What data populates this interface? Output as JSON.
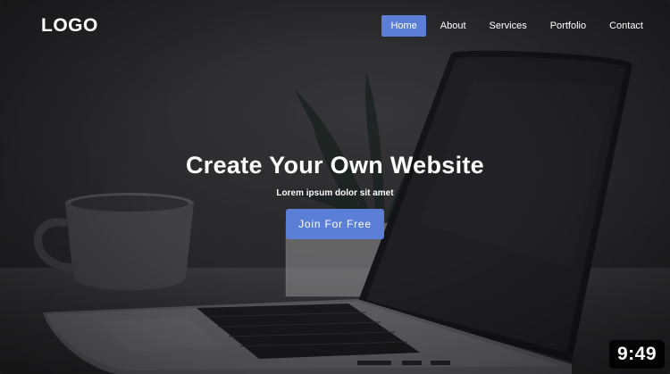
{
  "nav": {
    "logo": "LOGO",
    "items": [
      {
        "label": "Home",
        "active": true
      },
      {
        "label": "About",
        "active": false
      },
      {
        "label": "Services",
        "active": false
      },
      {
        "label": "Portfolio",
        "active": false
      },
      {
        "label": "Contact",
        "active": false
      }
    ]
  },
  "hero": {
    "title": "Create Your Own Website",
    "subtitle": "Lorem ipsum dolor sit amet",
    "cta_label": "Join For Free"
  },
  "video": {
    "duration": "9:49"
  },
  "colors": {
    "accent": "#5b7fd6",
    "overlay_dark": "#2b2b2e"
  },
  "background_icons": [
    "coffee-cup-icon",
    "plant-icon",
    "laptop-icon"
  ]
}
